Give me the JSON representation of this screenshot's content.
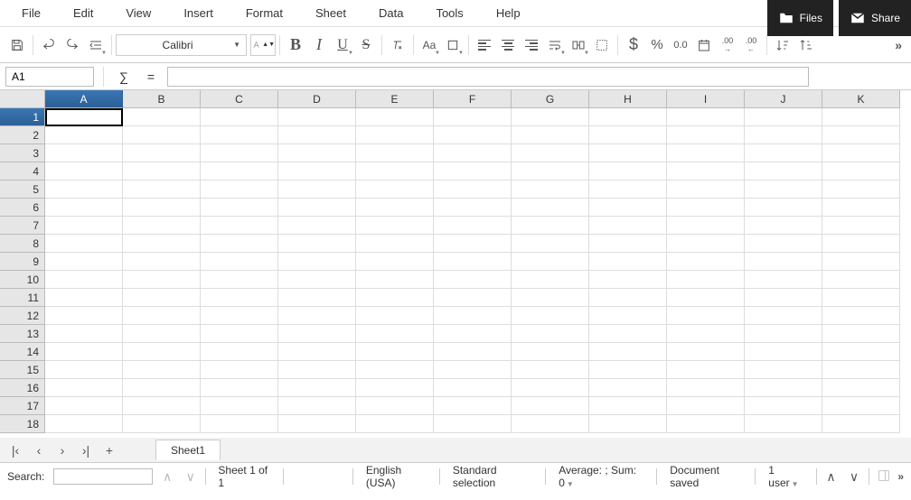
{
  "menu": {
    "items": [
      "File",
      "Edit",
      "View",
      "Insert",
      "Format",
      "Sheet",
      "Data",
      "Tools",
      "Help"
    ]
  },
  "top_buttons": {
    "files": "Files",
    "share": "Share"
  },
  "toolbar": {
    "font_name": "Calibri",
    "font_size_placeholder": "ᐱꜜ",
    "bold": "B",
    "italic": "I",
    "underline": "U",
    "strike": "S",
    "case": "Aa",
    "currency": "$",
    "percent": "%",
    "number_fmt": "0.0",
    "dec_more": ".00",
    "dec_less": ".00"
  },
  "formula": {
    "cell_ref": "A1",
    "sigma": "∑",
    "equals": "=",
    "value": ""
  },
  "grid": {
    "columns": [
      "A",
      "B",
      "C",
      "D",
      "E",
      "F",
      "G",
      "H",
      "I",
      "J",
      "K"
    ],
    "rows": [
      "1",
      "2",
      "3",
      "4",
      "5",
      "6",
      "7",
      "8",
      "9",
      "10",
      "11",
      "12",
      "13",
      "14",
      "15",
      "16",
      "17",
      "18"
    ],
    "selected_cell": "A1"
  },
  "tabs": {
    "sheet1": "Sheet1",
    "add": "+"
  },
  "status": {
    "search_label": "Search:",
    "sheet_info": "Sheet 1 of 1",
    "language": "English (USA)",
    "selection_mode": "Standard selection",
    "aggregate": "Average: ; Sum: 0",
    "save_state": "Document saved",
    "users": "1 user"
  }
}
